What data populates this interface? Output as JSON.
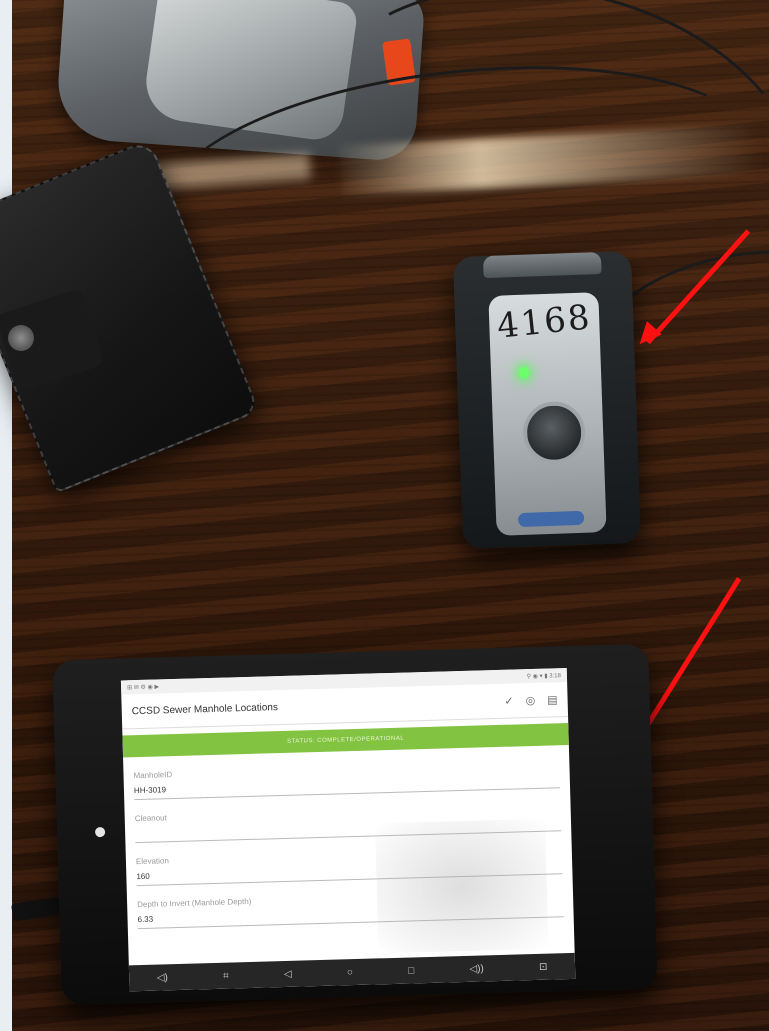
{
  "receiver": {
    "handwritten_label": "4168"
  },
  "tablet": {
    "status_bar": {
      "left_icons": "⊞ ✉ ⚙ ◉ ▶",
      "right_icons": "⚲ ◉ ▾ ▮ 3:18"
    },
    "app_title": "CCSD Sewer Manhole Locations",
    "actions": {
      "check_icon": "✓",
      "gps_icon": "◎",
      "save_icon": "▤"
    },
    "status_banner": "STATUS: COMPLETE/OPERATIONAL",
    "fields": [
      {
        "label": "ManholeID",
        "value": "HH-3019"
      },
      {
        "label": "Cleanout",
        "value": ""
      },
      {
        "label": "Elevation",
        "value": "160"
      },
      {
        "label": "Depth to Invert (Manhole Depth)",
        "value": "6.33"
      }
    ],
    "nav_icons": {
      "volume_down": "◁)",
      "screenshot": "⌗",
      "back": "◁",
      "home": "○",
      "recents": "□",
      "volume_up": "◁))",
      "rotate": "⊡"
    }
  },
  "colors": {
    "status_banner": "#82c341",
    "annotation_arrow": "#ff1111",
    "receiver_led": "#6cff6c"
  }
}
